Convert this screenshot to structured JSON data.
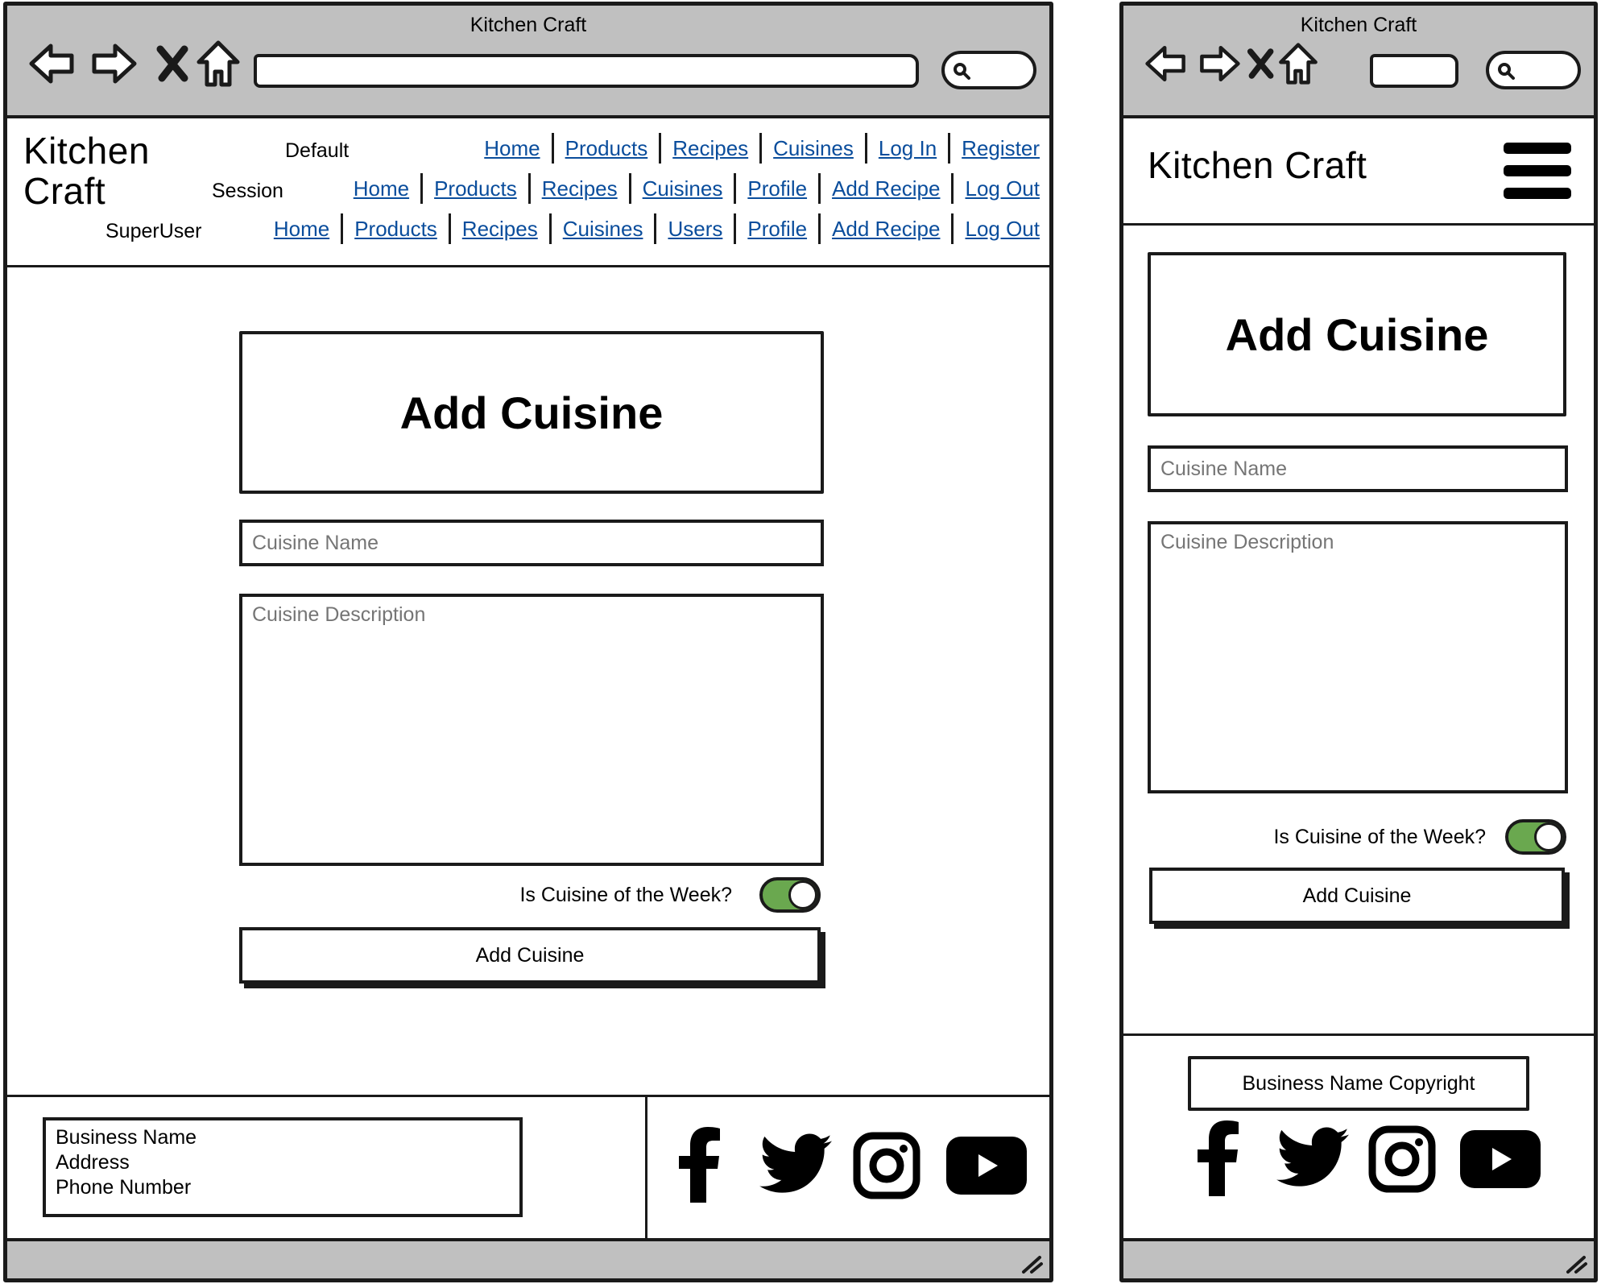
{
  "desktop": {
    "window_title": "Kitchen Craft",
    "logo_line1": "Kitchen",
    "logo_line2": "Craft",
    "nav_default": {
      "role": "Default",
      "links": [
        "Home",
        "Products",
        "Recipes",
        "Cuisines",
        "Log In",
        "Register"
      ]
    },
    "nav_session": {
      "role": "Session",
      "links": [
        "Home",
        "Products",
        "Recipes",
        "Cuisines",
        "Profile",
        "Add Recipe",
        "Log Out"
      ]
    },
    "nav_superuser": {
      "role": "SuperUser",
      "links": [
        "Home",
        "Products",
        "Recipes",
        "Cuisines",
        "Users",
        "Profile",
        "Add Recipe",
        "Log Out"
      ]
    },
    "form": {
      "heading": "Add Cuisine",
      "name_placeholder": "Cuisine Name",
      "description_placeholder": "Cuisine Description",
      "toggle_label": "Is Cuisine of the Week?",
      "toggle_on": true,
      "submit_label": "Add Cuisine"
    },
    "footer": {
      "business_name": "Business Name",
      "address": "Address",
      "phone": "Phone Number"
    }
  },
  "mobile": {
    "window_title": "Kitchen Craft",
    "logo": "Kitchen Craft",
    "form": {
      "heading": "Add Cuisine",
      "name_placeholder": "Cuisine Name",
      "description_placeholder": "Cuisine Description",
      "toggle_label": "Is Cuisine of the Week?",
      "toggle_on": true,
      "submit_label": "Add Cuisine"
    },
    "footer": {
      "copyright": "Business Name Copyright"
    }
  },
  "icons": [
    "back-arrow-icon",
    "forward-arrow-icon",
    "close-icon",
    "home-icon",
    "search-icon",
    "facebook-icon",
    "twitter-icon",
    "instagram-icon",
    "youtube-icon",
    "hamburger-menu-icon",
    "resize-grip-icon"
  ],
  "colors": {
    "chrome": "#c0c0c0",
    "link": "#0a4d9c",
    "toggle_on": "#6aa84f",
    "stroke": "#1a1a1a"
  }
}
